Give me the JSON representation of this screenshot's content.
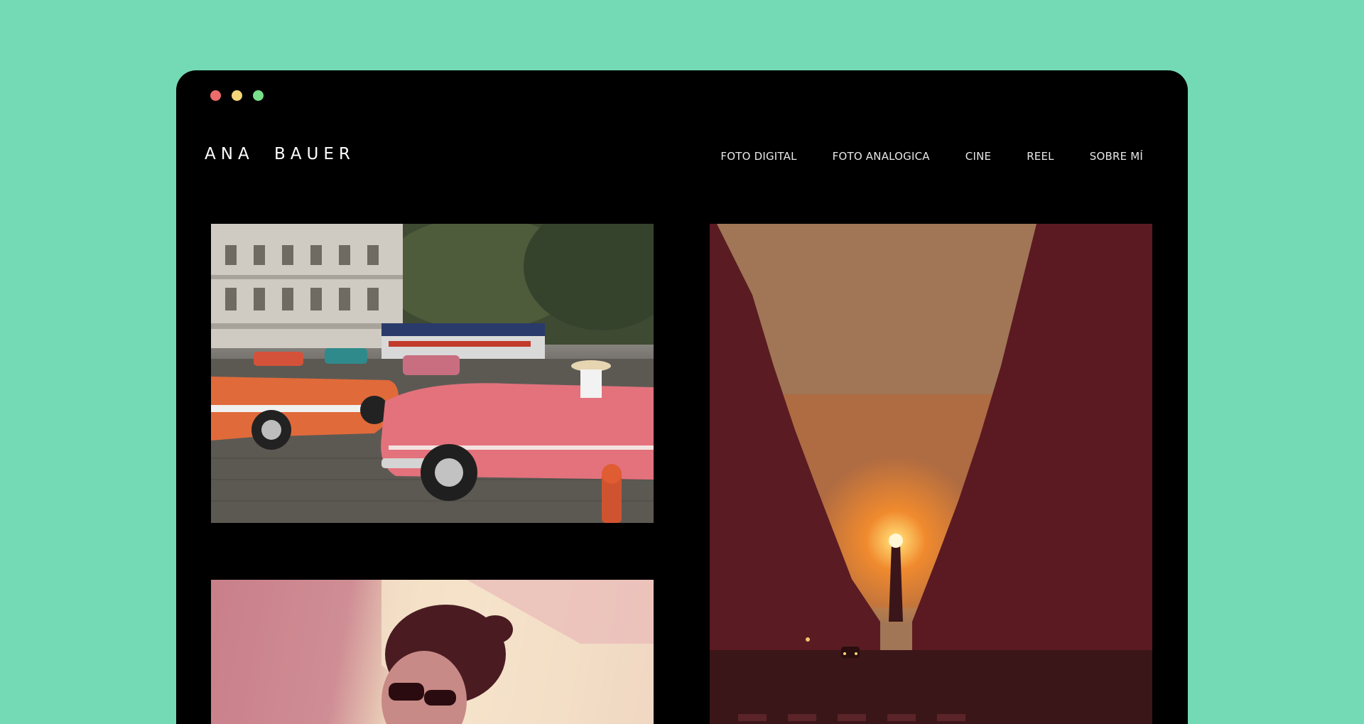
{
  "window": {
    "traffic_lights": [
      {
        "name": "close",
        "color": "#ee6b6b"
      },
      {
        "name": "minimize",
        "color": "#f5d77a"
      },
      {
        "name": "maximize",
        "color": "#78e08a"
      }
    ]
  },
  "header": {
    "brand": "ANA BAUER",
    "nav": [
      {
        "label": "FOTO DIGITAL"
      },
      {
        "label": "FOTO ANALOGICA"
      },
      {
        "label": "CINE"
      },
      {
        "label": "REEL"
      },
      {
        "label": "SOBRE MÍ"
      }
    ]
  },
  "gallery": {
    "photos": [
      {
        "subject": "classic-cars-street"
      },
      {
        "subject": "sunset-street-obelisk"
      },
      {
        "subject": "portrait-sunglasses"
      }
    ]
  },
  "colors": {
    "page_background": "#74dab5",
    "window_background": "#000000"
  }
}
